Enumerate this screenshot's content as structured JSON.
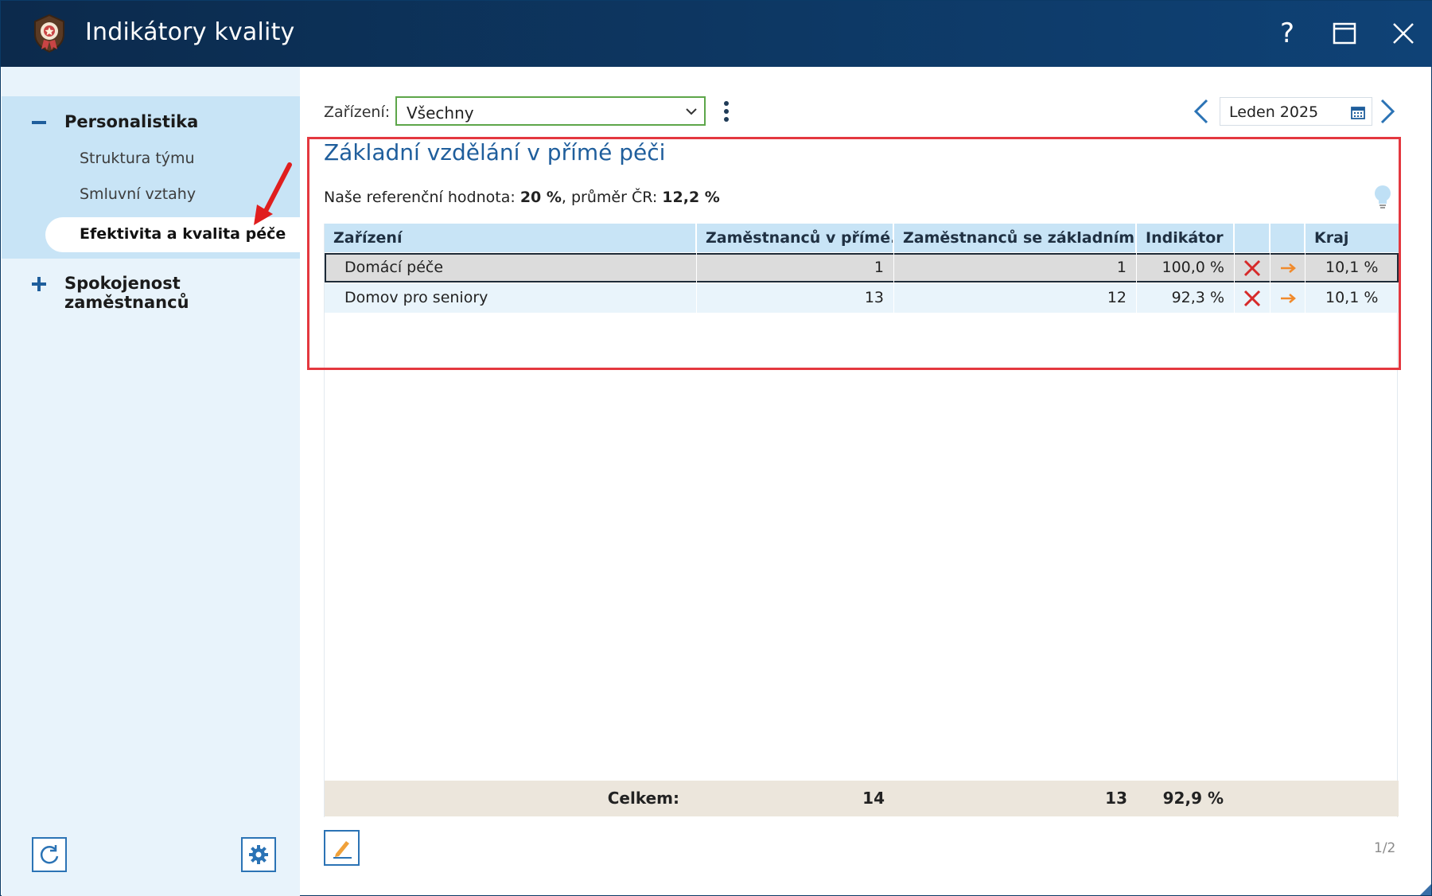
{
  "window": {
    "title": "Indikátory kvality",
    "help_label": "?",
    "icons": {
      "app": "medal-icon",
      "help": "help-icon",
      "maximize": "maximize-icon",
      "close": "close-icon"
    }
  },
  "sidebar": {
    "groups": [
      {
        "label": "Personalistika",
        "expanded": true,
        "sign": "−",
        "items": [
          {
            "label": "Struktura týmu",
            "active": false
          },
          {
            "label": "Smluvní vztahy",
            "active": false
          },
          {
            "label": "Efektivita a kvalita péče",
            "active": true
          }
        ]
      },
      {
        "label": "Spokojenost zaměstnanců",
        "expanded": false,
        "sign": "+"
      }
    ],
    "bottom_buttons": {
      "refresh": "refresh-icon",
      "settings": "gear-icon"
    }
  },
  "toolbar": {
    "facility_label": "Zařízení:",
    "facility_value": "Všechny",
    "period_value": "Leden 2025"
  },
  "card": {
    "title": "Základní vzdělání v přímé péči",
    "ref_prefix": "Naše referenční hodnota:",
    "ref_value": "20 %",
    "avg_prefix": ", průměr ČR:",
    "avg_value": "12,2 %"
  },
  "table": {
    "columns": [
      "Zařízení",
      "Zaměstnanců v přímé...",
      "Zaměstnanců se základním...",
      "Indikátor",
      "",
      "",
      "Kraj"
    ],
    "rows": [
      {
        "facility": "Domácí péče",
        "direct_care": "1",
        "basic_edu": "1",
        "indicator": "100,0 %",
        "status_icon": "cross-icon",
        "trend_icon": "arrow-right-icon",
        "region": "10,1 %",
        "selected": true
      },
      {
        "facility": "Domov pro seniory",
        "direct_care": "13",
        "basic_edu": "12",
        "indicator": "92,3 %",
        "status_icon": "cross-icon",
        "trend_icon": "arrow-right-icon",
        "region": "10,1 %",
        "selected": false
      }
    ],
    "totals": {
      "label": "Celkem:",
      "direct_care": "14",
      "basic_edu": "13",
      "indicator": "92,9 %"
    }
  },
  "pager": "1/2",
  "colors": {
    "titlebar": "#0d3864",
    "accent": "#1f5e9c",
    "sidebar_group": "#c8e4f6",
    "select_border": "#5da64a",
    "status_cross": "#d62a2a",
    "trend_arrow": "#f08a2c",
    "highlight": "#e4383f"
  }
}
